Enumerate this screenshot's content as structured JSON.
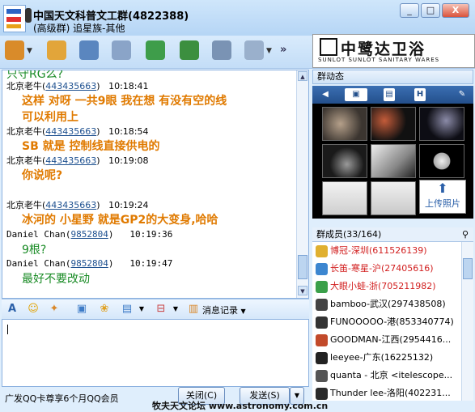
{
  "window": {
    "title": "中国天文科普文工群(4822388)",
    "subtitle": "(高级群) 追星族-其他",
    "btn_min": "_",
    "btn_max": "□",
    "btn_close": "X"
  },
  "chat": {
    "partial_top": "只守RG么?",
    "messages": [
      {
        "sender": "北京老牛",
        "qq": "443435663",
        "time": "10:18:41",
        "text": "这样 对呀 一共9眼  我在想 有没有空的线",
        "text2": "可以利用上"
      },
      {
        "sender": "北京老牛",
        "qq": "443435663",
        "time": "10:18:54",
        "text": "SB 就是 控制线直接供电的"
      },
      {
        "sender": "北京老牛",
        "qq": "443435663",
        "time": "10:19:08",
        "text": "你说呢?"
      },
      {
        "sender": "北京老牛",
        "qq": "443435663",
        "time": "10:19:24",
        "text": "冰河的 小星野 就是GP2的大变身,哈哈"
      },
      {
        "sender": "Daniel Chan",
        "qq": "9852804",
        "time": "10:19:36",
        "text": "9根?"
      },
      {
        "sender": "Daniel Chan",
        "qq": "9852804",
        "time": "10:19:47",
        "text": "最好不要改动"
      }
    ]
  },
  "format_toolbar": {
    "font_label": "A",
    "history_label": "消息记录"
  },
  "bottom": {
    "promo": "广发QQ卡尊享6个月QQ会员",
    "close_label": "关闭(C)",
    "send_label": "发送(S)",
    "watermark": "牧夫天文论坛 www.astronomy.com.cn"
  },
  "banner": {
    "brand_cn": "中鹭达卫浴",
    "brand_en": "SUNLOT   SUNLOT SANITARY WARES"
  },
  "group_status": {
    "header": "群动态",
    "upload_label": "上传照片"
  },
  "members": {
    "header": "群成员(33/164)",
    "list": [
      {
        "name": "博冠-深圳(611526139)",
        "color": "#d22020"
      },
      {
        "name": "长笛-寒星-沪(27405616)",
        "color": "#d22020"
      },
      {
        "name": "大眼小蛙-浙(705211982)",
        "color": "#d22020"
      },
      {
        "name": "bamboo-武汉(297438508)",
        "color": "#000000"
      },
      {
        "name": "FUNOOOOO-港(853340774)",
        "color": "#000000"
      },
      {
        "name": "GOODMAN-江西(2954416...",
        "color": "#000000"
      },
      {
        "name": "leeyee-广东(16225132)",
        "color": "#000000"
      },
      {
        "name": "quanta - 北京 <itelescope...",
        "color": "#000000"
      },
      {
        "name": "Thunder lee-洛阳(402231...",
        "color": "#000000"
      }
    ]
  }
}
